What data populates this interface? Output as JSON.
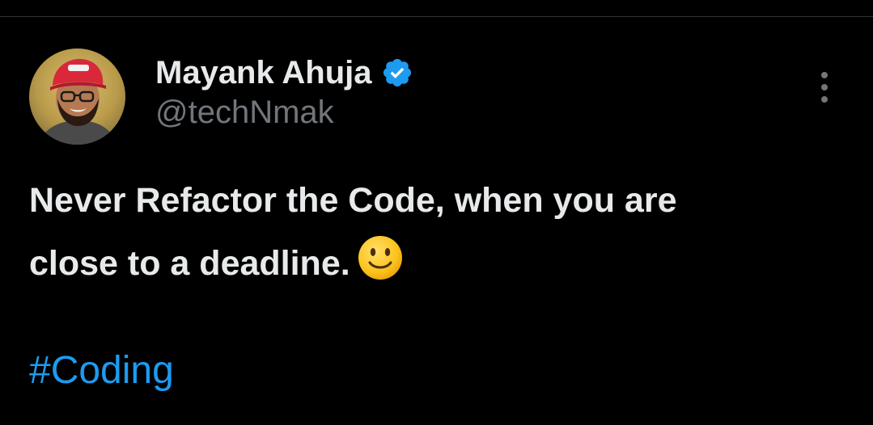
{
  "tweet": {
    "author": {
      "display_name": "Mayank Ahuja",
      "handle": "@techNmak",
      "verified": true,
      "avatar_icon": "profile-photo-icon"
    },
    "text_line_1": "Never Refactor the Code, when you are",
    "text_line_2": "close to a deadline.",
    "emoji": "slightly-smiling-face-icon",
    "hashtag": "#Coding",
    "more_icon": "more-options-icon"
  },
  "colors": {
    "background": "#000000",
    "text_primary": "#e7e9ea",
    "text_secondary": "#71767b",
    "link": "#1d9bf0",
    "verified_badge": "#1d9bf0",
    "divider": "#2f3336"
  }
}
